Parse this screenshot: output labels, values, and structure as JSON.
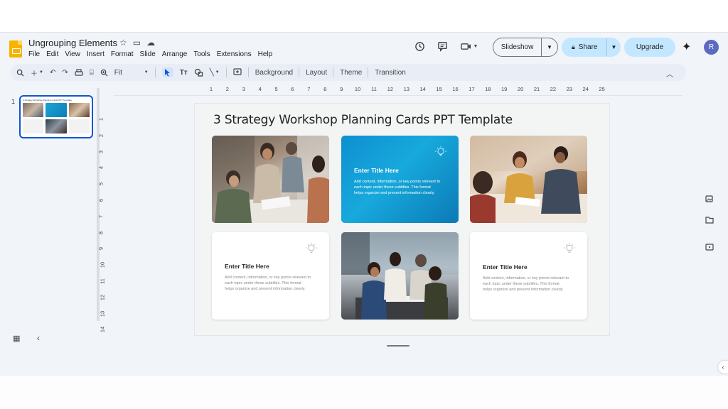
{
  "app": {
    "doc_title": "Ungrouping Elements",
    "menu": [
      "File",
      "Edit",
      "View",
      "Insert",
      "Format",
      "Slide",
      "Arrange",
      "Tools",
      "Extensions",
      "Help"
    ]
  },
  "header": {
    "slideshow_label": "Slideshow",
    "share_label": "Share",
    "upgrade_label": "Upgrade",
    "avatar_initial": "R"
  },
  "toolbar": {
    "zoom_value": "Fit",
    "background_label": "Background",
    "layout_label": "Layout",
    "theme_label": "Theme",
    "transition_label": "Transition"
  },
  "filmstrip": {
    "slide_number": "1",
    "thumb_title": "3 Strategy Workshop Planning Cards PPT Template"
  },
  "ruler": {
    "horizontal": [
      "1",
      "2",
      "3",
      "4",
      "5",
      "6",
      "7",
      "8",
      "9",
      "10",
      "11",
      "12",
      "13",
      "14",
      "15",
      "16",
      "17",
      "18",
      "19",
      "20",
      "21",
      "22",
      "23",
      "24",
      "25"
    ],
    "vertical": [
      "1",
      "2",
      "3",
      "4",
      "5",
      "6",
      "7",
      "8",
      "9",
      "10",
      "11",
      "12",
      "13",
      "14"
    ]
  },
  "slide": {
    "title": "3 Strategy Workshop Planning Cards PPT Template",
    "cards": [
      {
        "title": "Enter Title Here",
        "body": "Add content, information, or key points relevant to each topic under these subtitles. This format helps organize and present information clearly."
      },
      {
        "title": "Enter Title Here",
        "body": "Add content, information, or key points relevant to each topic under these subtitles. This format helps organize and present information clearly."
      },
      {
        "title": "Enter Title Here",
        "body": "Add content, information, or key points relevant to each topic under these subtitles. This format helps organize and present information clearly."
      }
    ]
  },
  "colors": {
    "accent": "#0b57d0",
    "card_blue": "#1aa3d6",
    "share_bg": "#c2e7ff"
  }
}
